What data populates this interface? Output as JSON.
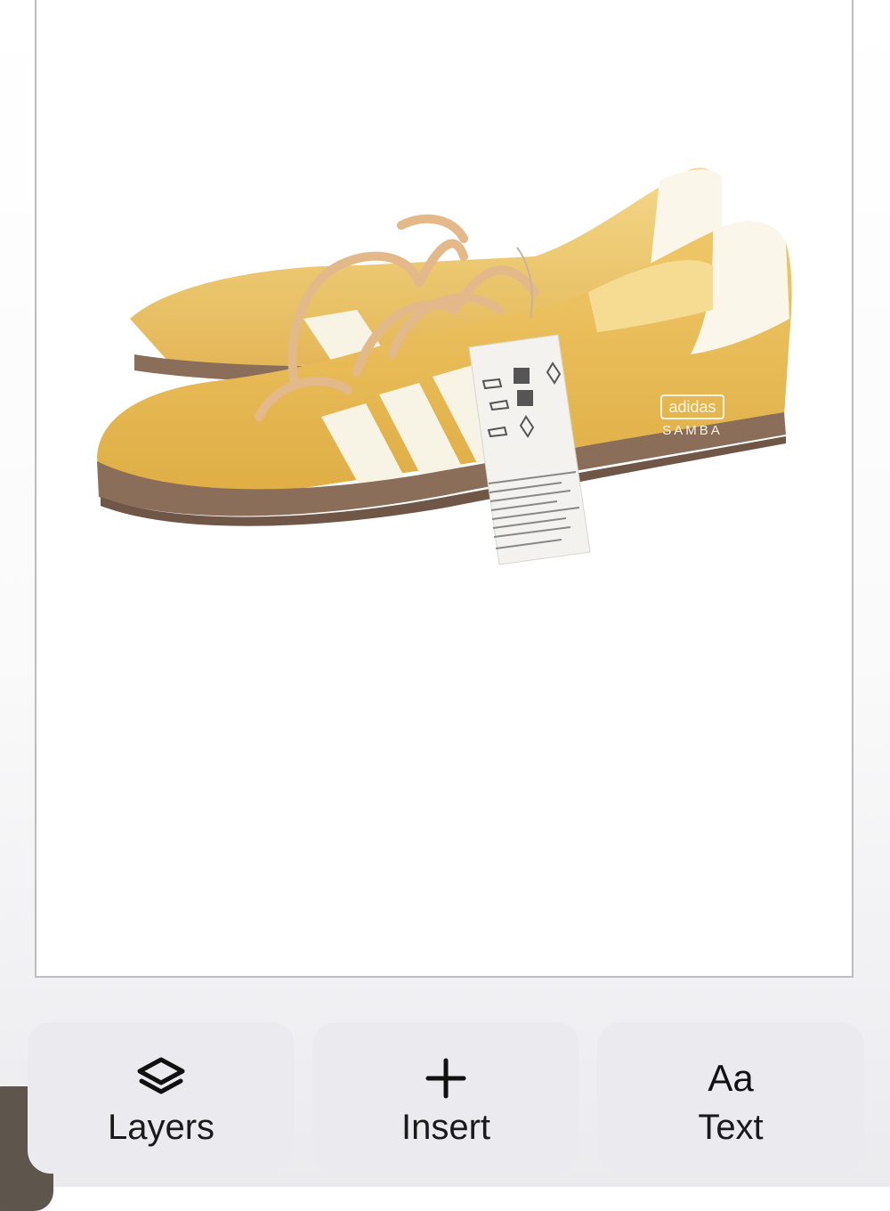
{
  "canvas": {
    "photo": {
      "brand_logo": "adidas",
      "model_name": "SAMBA",
      "shoe_color": "#E9BC5A",
      "stripe_color": "#F7F4E6",
      "sole_color": "#8B6E5A",
      "lace_color": "#E3B98A"
    }
  },
  "toolbar": {
    "layers_label": "Layers",
    "insert_label": "Insert",
    "text_label": "Text",
    "text_icon_glyph": "Aa"
  },
  "colors": {
    "button_bg": "#EBEBEF",
    "label": "#1A1A1A",
    "canvas_border": "#BDBDBD",
    "swatch": "#5E554C"
  }
}
